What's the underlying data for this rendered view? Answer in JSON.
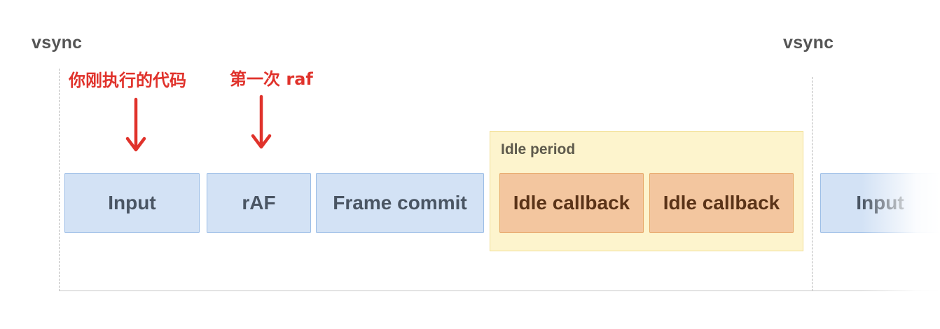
{
  "vsync": {
    "left_label": "vsync",
    "right_label": "vsync"
  },
  "annotations": {
    "code": "你刚执行的代码",
    "raf": "第一次 raf"
  },
  "idle_period": {
    "label": "Idle period"
  },
  "blocks": [
    {
      "label": "Input",
      "kind": "task"
    },
    {
      "label": "rAF",
      "kind": "task"
    },
    {
      "label": "Frame commit",
      "kind": "task"
    },
    {
      "label": "Idle callback",
      "kind": "idle"
    },
    {
      "label": "Idle callback",
      "kind": "idle"
    },
    {
      "label": "Input",
      "kind": "task"
    }
  ],
  "colors": {
    "task_fill": "#d3e2f5",
    "task_border": "#9bbde6",
    "idle_fill": "#f3c69f",
    "idle_border": "#e6a868",
    "idle_period_fill": "#fdf4cd",
    "annotation": "#e0322b"
  },
  "icons": {
    "annotation_arrow": "arrow-down-icon"
  }
}
